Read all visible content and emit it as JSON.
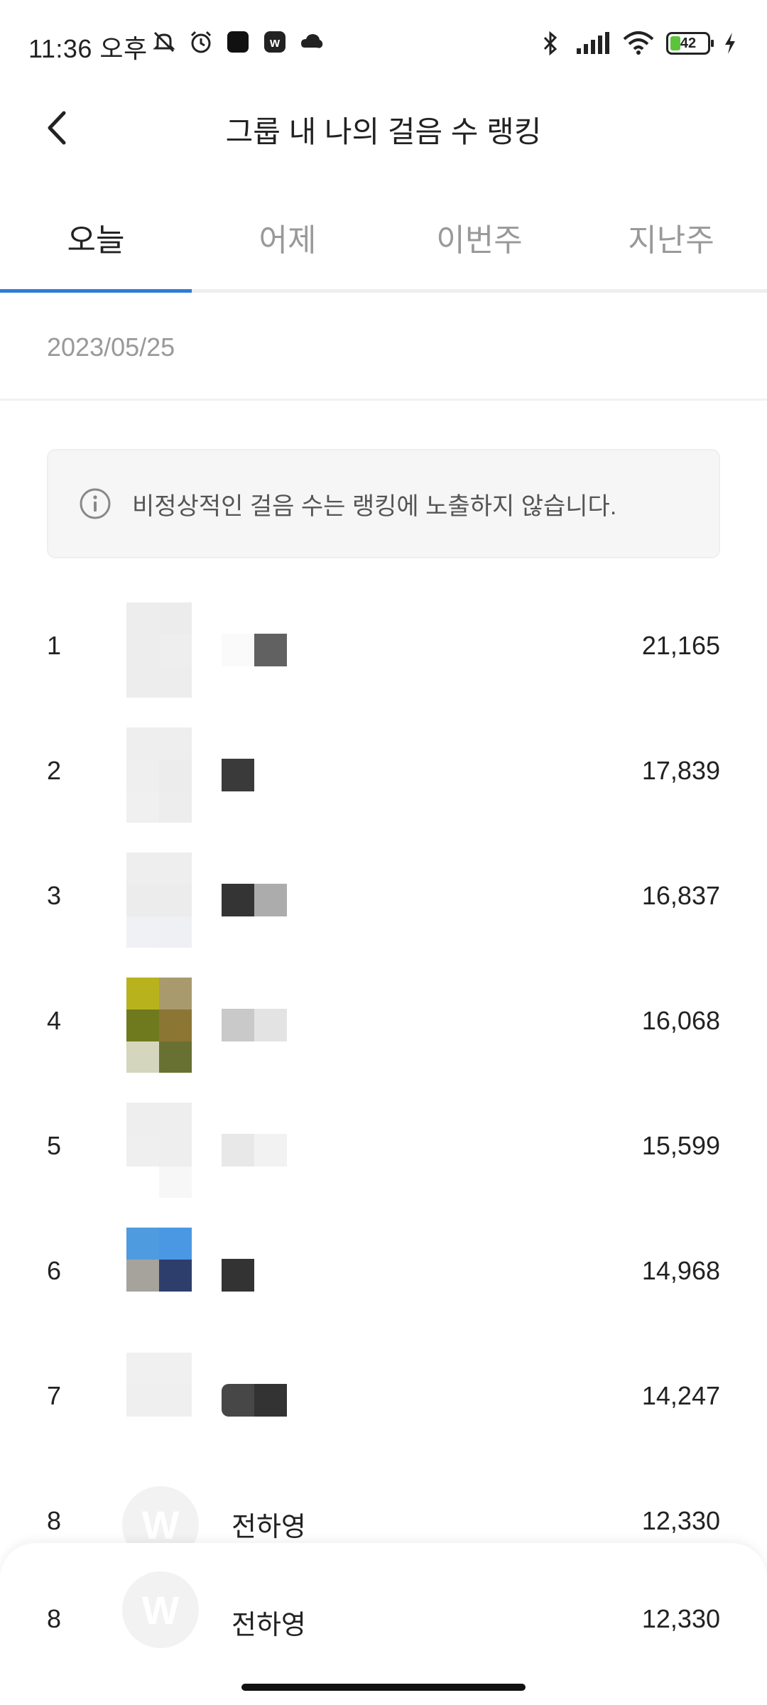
{
  "status_bar": {
    "time": "11:36 오후",
    "battery": "42",
    "left_icons": [
      "mute-icon",
      "alarm-icon",
      "app-black-icon",
      "w-app-icon",
      "cloud-icon"
    ],
    "right_icons": [
      "bluetooth-icon",
      "signal-icon",
      "wifi-icon",
      "battery-icon",
      "charging-icon"
    ]
  },
  "header": {
    "title": "그룹 내 나의 걸음 수 랭킹",
    "back_icon": "chevron-left-icon"
  },
  "tabs": [
    {
      "label": "오늘",
      "active": true
    },
    {
      "label": "어제",
      "active": false
    },
    {
      "label": "이번주",
      "active": false
    },
    {
      "label": "지난주",
      "active": false
    }
  ],
  "colors": {
    "accent": "#2f7bd6",
    "text": "#222222",
    "muted": "#999999",
    "notice_bg": "#f6f6f6"
  },
  "date": "2023/05/25",
  "notice": {
    "icon": "info-icon",
    "text": "비정상적인 걸음 수는 랭킹에 노출하지 않습니다."
  },
  "ranking": [
    {
      "rank": "1",
      "name": "",
      "steps": "21,165"
    },
    {
      "rank": "2",
      "name": "",
      "steps": "17,839"
    },
    {
      "rank": "3",
      "name": "",
      "steps": "16,837"
    },
    {
      "rank": "4",
      "name": "",
      "steps": "16,068"
    },
    {
      "rank": "5",
      "name": "",
      "steps": "15,599"
    },
    {
      "rank": "6",
      "name": "",
      "steps": "14,968"
    },
    {
      "rank": "7",
      "name": "",
      "steps": "14,247"
    },
    {
      "rank": "8",
      "name": "전하영",
      "steps": "12,330",
      "avatar_letter": "W"
    }
  ],
  "my_rank": {
    "rank": "8",
    "name": "전하영",
    "steps": "12,330",
    "avatar_letter": "W"
  }
}
